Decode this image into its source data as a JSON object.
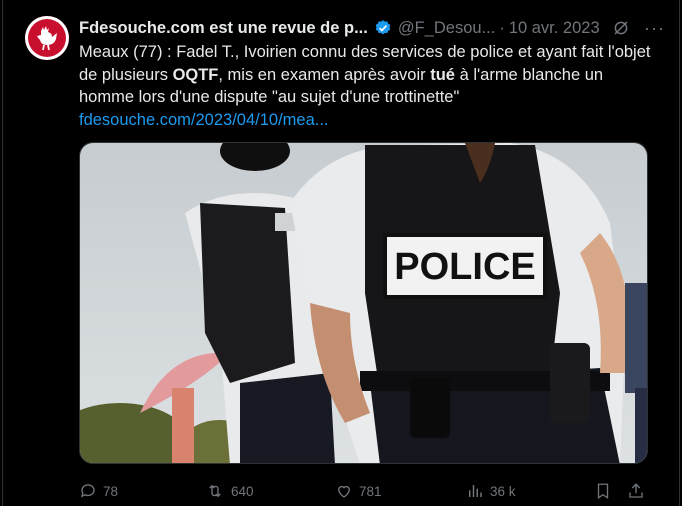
{
  "tweet": {
    "author_name": "Fdesouche.com est une revue de p...",
    "handle": "@F_Desou...",
    "separator": "·",
    "date": "10 avr. 2023",
    "more": "···",
    "text_part1": "Meaux (77) : Fadel T., Ivoirien connu des services de police et ayant fait l'objet de plusieurs ",
    "text_bold1": "OQTF",
    "text_part2": ", mis en examen après avoir ",
    "text_bold2": "tué",
    "text_part3": " à l'arme blanche un homme lors d'une dispute \"au sujet d'une trottinette\"",
    "link": "fdesouche.com/2023/04/10/mea...",
    "image_badge_text": "POLICE"
  },
  "actions": {
    "replies": "78",
    "retweets": "640",
    "likes": "781",
    "views": "36 k"
  },
  "colors": {
    "background": "#000000",
    "text": "#e7e9ea",
    "muted": "#71767b",
    "link": "#1d9bf0",
    "verified": "#1d9bf0",
    "avatar": "#c8102e"
  }
}
